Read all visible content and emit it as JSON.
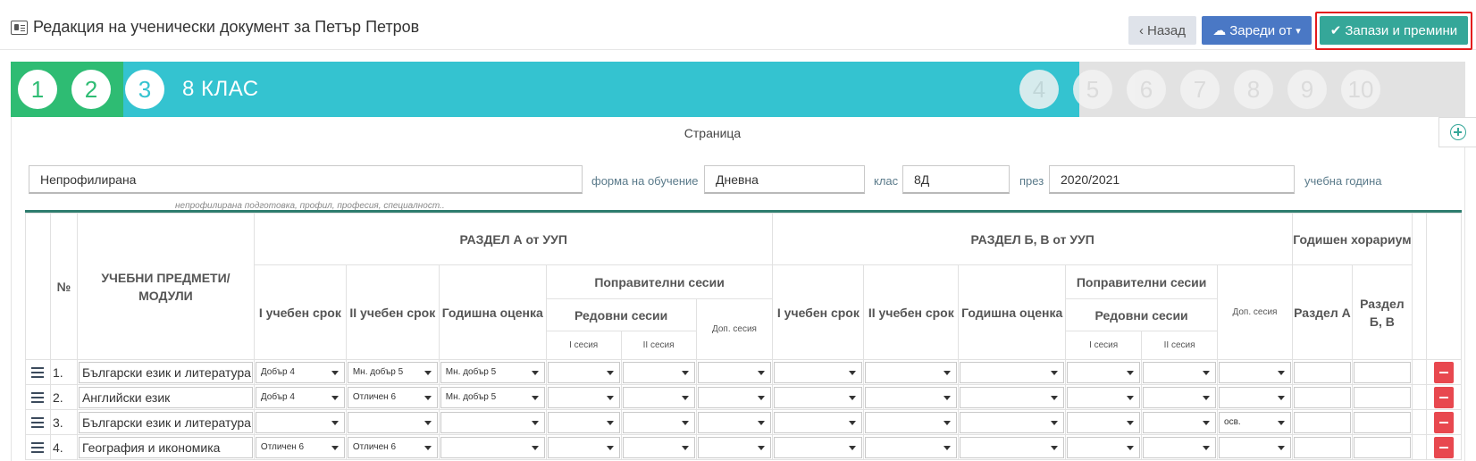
{
  "header": {
    "title": "Редакция на ученически документ за Петър Петров",
    "back_label": "Назад",
    "load_label": "Зареди от",
    "save_label": "Запази и премини",
    "save_highlight_color": "#e31b1b"
  },
  "steps": {
    "done": [
      "1",
      "2"
    ],
    "active": "3",
    "active_label": "8 КЛАС",
    "future": [
      "4",
      "5",
      "6",
      "7",
      "8",
      "9",
      "10"
    ],
    "colors": {
      "done": "#2ebc73",
      "active": "#34c3d0",
      "future": "#e2e2e2"
    }
  },
  "form": {
    "page_label": "Страница",
    "profile_value": "Непрофилирана",
    "profile_hint": "непрофилирана подготовка, профил, професия, специалност..",
    "form_label": "форма на обучение",
    "form_value": "Дневна",
    "class_label": "клас",
    "class_value": "8Д",
    "year_prefix": "през",
    "year_value": "2020/2021",
    "year_suffix": "учебна година"
  },
  "table": {
    "num_header": "№",
    "subject_header": "УЧЕБНИ ПРЕДМЕТИ/ МОДУЛИ",
    "section_a": "РАЗДЕЛ А от УУП",
    "section_b": "РАЗДЕЛ Б, В от УУП",
    "annual_hours": "Годишен хорариум",
    "term1": "I учебен срок",
    "term2": "II учебен срок",
    "annual_grade": "Годишна оценка",
    "corrective": "Поправителни сесии",
    "regular": "Редовни сесии",
    "extra": "Доп. сесия",
    "session1": "I сесия",
    "session2": "II сесия",
    "hours_a": "Раздел А",
    "hours_b": "Раздел Б, В",
    "rows": [
      {
        "num": "1.",
        "subject": "Български език и литература",
        "a": [
          "Добър 4",
          "Мн. добър 5",
          "Мн. добър 5",
          "",
          "",
          ""
        ],
        "b": [
          "",
          "",
          "",
          "",
          "",
          ""
        ]
      },
      {
        "num": "2.",
        "subject": "Английски език",
        "a": [
          "Добър 4",
          "Отличен 6",
          "Мн. добър 5",
          "",
          "",
          ""
        ],
        "b": [
          "",
          "",
          "",
          "",
          "",
          ""
        ]
      },
      {
        "num": "3.",
        "subject": "Български език и литература",
        "a": [
          "",
          "",
          "",
          "",
          "",
          ""
        ],
        "b": [
          "",
          "",
          "",
          "",
          "",
          "осв."
        ]
      },
      {
        "num": "4.",
        "subject": "География и икономика",
        "a": [
          "Отличен 6",
          "Отличен 6",
          "",
          "",
          "",
          ""
        ],
        "b": [
          "",
          "",
          "",
          "",
          "",
          ""
        ]
      }
    ]
  }
}
